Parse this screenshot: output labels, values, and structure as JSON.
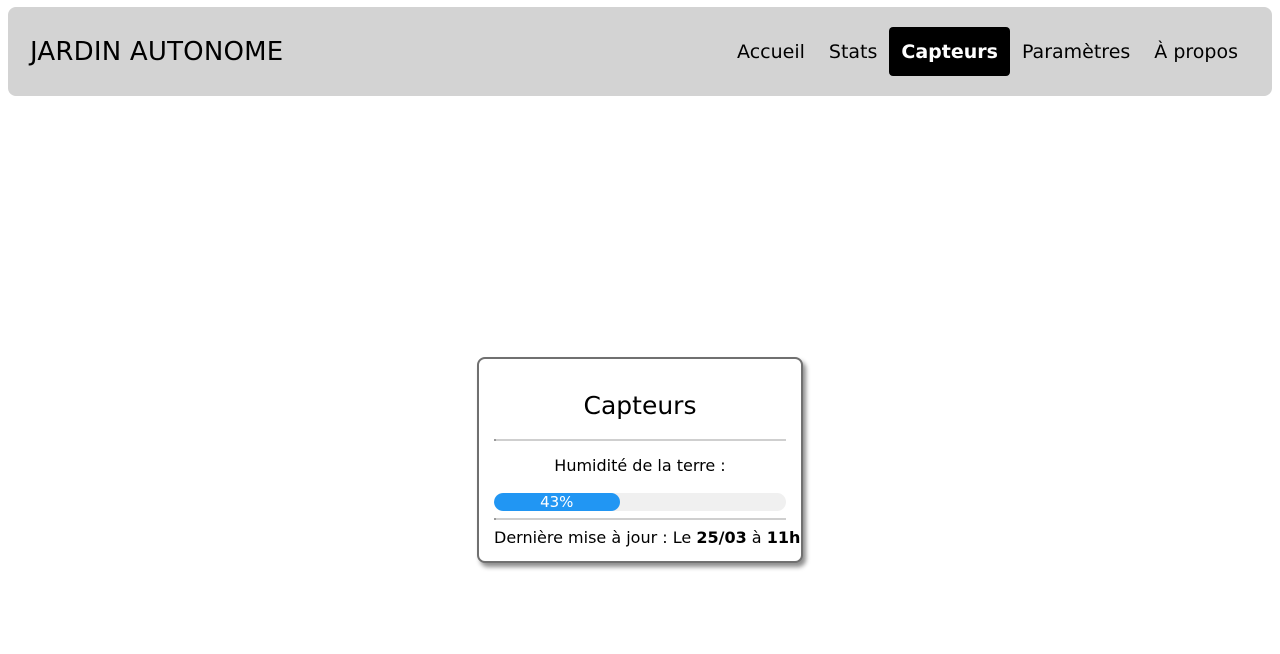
{
  "header": {
    "brand": "JARDIN AUTONOME",
    "nav": [
      {
        "label": "Accueil",
        "active": false
      },
      {
        "label": "Stats",
        "active": false
      },
      {
        "label": "Capteurs",
        "active": true
      },
      {
        "label": "Paramètres",
        "active": false
      },
      {
        "label": "À propos",
        "active": false
      }
    ]
  },
  "card": {
    "title": "Capteurs",
    "humidity_label": "Humidité de la terre :",
    "humidity_value": 0.43,
    "humidity_text": "43%",
    "update_prefix": "Dernière mise à jour : Le",
    "update_date": "25/03",
    "update_mid": "à",
    "update_time": "11h"
  },
  "colors": {
    "navbar_bg": "#d3d3d3",
    "active_bg": "#000000",
    "progress_fill": "#2196f3",
    "progress_track": "#f0f0f0"
  }
}
